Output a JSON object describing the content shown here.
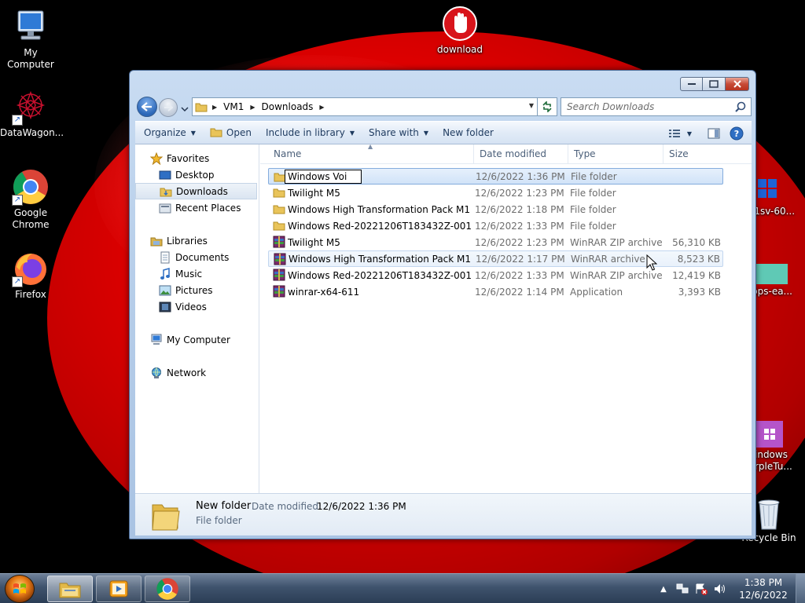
{
  "desktop": {
    "icons": [
      {
        "id": "my-computer",
        "label": "My Computer"
      },
      {
        "id": "download",
        "label": "download"
      },
      {
        "id": "datawagon",
        "label": "DataWagon..."
      },
      {
        "id": "google-chrome",
        "label": "Google Chrome"
      },
      {
        "id": "firefox",
        "label": "Firefox"
      },
      {
        "id": "partial-1",
        "label": "j1sv-60..."
      },
      {
        "id": "partial-2",
        "label": "pps-ea..."
      },
      {
        "id": "windows-purple",
        "label": "indows rpleTu..."
      },
      {
        "id": "recycle-bin",
        "label": "Recycle Bin"
      }
    ]
  },
  "window": {
    "address": {
      "segments": [
        "VM1",
        "Downloads"
      ]
    },
    "search": {
      "placeholder": "Search Downloads"
    },
    "commands": {
      "organize": "Organize",
      "open": "Open",
      "include_in_library": "Include in library",
      "share_with": "Share with",
      "new_folder": "New folder"
    },
    "nav": {
      "favorites": "Favorites",
      "desktop": "Desktop",
      "downloads": "Downloads",
      "recent_places": "Recent Places",
      "libraries": "Libraries",
      "documents": "Documents",
      "music": "Music",
      "pictures": "Pictures",
      "videos": "Videos",
      "my_computer": "My Computer",
      "network": "Network"
    },
    "columns": {
      "name": "Name",
      "date": "Date modified",
      "type": "Type",
      "size": "Size"
    },
    "rename_value": "Windows Voi",
    "files": [
      {
        "name": "",
        "date": "12/6/2022 1:36 PM",
        "type": "File folder",
        "size": "",
        "kind": "folder"
      },
      {
        "name": "Twilight M5",
        "date": "12/6/2022 1:23 PM",
        "type": "File folder",
        "size": "",
        "kind": "folder"
      },
      {
        "name": "Windows High Transformation Pack M1",
        "date": "12/6/2022 1:18 PM",
        "type": "File folder",
        "size": "",
        "kind": "folder"
      },
      {
        "name": "Windows Red-20221206T183432Z-001",
        "date": "12/6/2022 1:33 PM",
        "type": "File folder",
        "size": "",
        "kind": "folder"
      },
      {
        "name": "Twilight M5",
        "date": "12/6/2022 1:23 PM",
        "type": "WinRAR ZIP archive",
        "size": "56,310 KB",
        "kind": "archive"
      },
      {
        "name": "Windows High Transformation Pack M1",
        "date": "12/6/2022 1:17 PM",
        "type": "WinRAR archive",
        "size": "8,523 KB",
        "kind": "archive"
      },
      {
        "name": "Windows Red-20221206T183432Z-001",
        "date": "12/6/2022 1:33 PM",
        "type": "WinRAR ZIP archive",
        "size": "12,419 KB",
        "kind": "archive"
      },
      {
        "name": "winrar-x64-611",
        "date": "12/6/2022 1:14 PM",
        "type": "Application",
        "size": "3,393 KB",
        "kind": "app"
      }
    ],
    "details": {
      "name": "New folder",
      "date_label": "Date modified:",
      "date_value": "12/6/2022 1:36 PM",
      "type": "File folder"
    }
  },
  "taskbar": {
    "clock_time": "1:38 PM",
    "clock_date": "12/6/2022"
  },
  "colors": {
    "selection": "#d1e3f8",
    "accent": "#2c67b8",
    "wallpaper": "#e00000"
  }
}
